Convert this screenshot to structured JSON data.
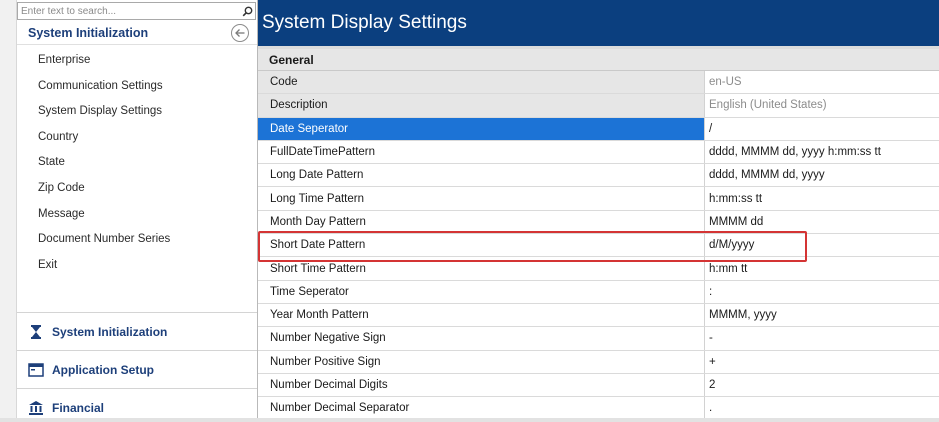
{
  "search": {
    "placeholder": "Enter text to search..."
  },
  "nav": {
    "header": "System Initialization",
    "items": [
      {
        "label": "Enterprise"
      },
      {
        "label": "Communication Settings"
      },
      {
        "label": "System Display Settings"
      },
      {
        "label": "Country"
      },
      {
        "label": "State"
      },
      {
        "label": "Zip Code"
      },
      {
        "label": "Message"
      },
      {
        "label": "Document Number Series"
      },
      {
        "label": "Exit"
      }
    ],
    "groups": [
      {
        "label": "System Initialization",
        "icon": "hourglass-icon"
      },
      {
        "label": "Application Setup",
        "icon": "window-icon"
      },
      {
        "label": "Financial",
        "icon": "bank-icon"
      }
    ]
  },
  "page": {
    "title": "System Display Settings"
  },
  "grid": {
    "section": "General",
    "rows": [
      {
        "label": "Code",
        "value": "en-US"
      },
      {
        "label": "Description",
        "value": "English (United States)"
      },
      {
        "label": "Date Seperator",
        "value": "/"
      },
      {
        "label": "FullDateTimePattern",
        "value": "dddd, MMMM dd, yyyy h:mm:ss tt"
      },
      {
        "label": "Long Date Pattern",
        "value": "dddd, MMMM dd, yyyy"
      },
      {
        "label": "Long Time Pattern",
        "value": "h:mm:ss tt"
      },
      {
        "label": "Month Day Pattern",
        "value": "MMMM dd"
      },
      {
        "label": "Short Date Pattern",
        "value": "d/M/yyyy"
      },
      {
        "label": "Short Time Pattern",
        "value": "h:mm tt"
      },
      {
        "label": "Time Seperator",
        "value": ":"
      },
      {
        "label": "Year Month Pattern",
        "value": "MMMM, yyyy"
      },
      {
        "label": "Number Negative Sign",
        "value": "-"
      },
      {
        "label": "Number Positive Sign",
        "value": "+"
      },
      {
        "label": "Number Decimal Digits",
        "value": "2"
      },
      {
        "label": "Number Decimal Separator",
        "value": "."
      }
    ]
  },
  "colors": {
    "titlebar": "#0b3f7f",
    "selection": "#1c73d6",
    "highlight": "#d43434",
    "nav_text": "#1d3f7a"
  }
}
